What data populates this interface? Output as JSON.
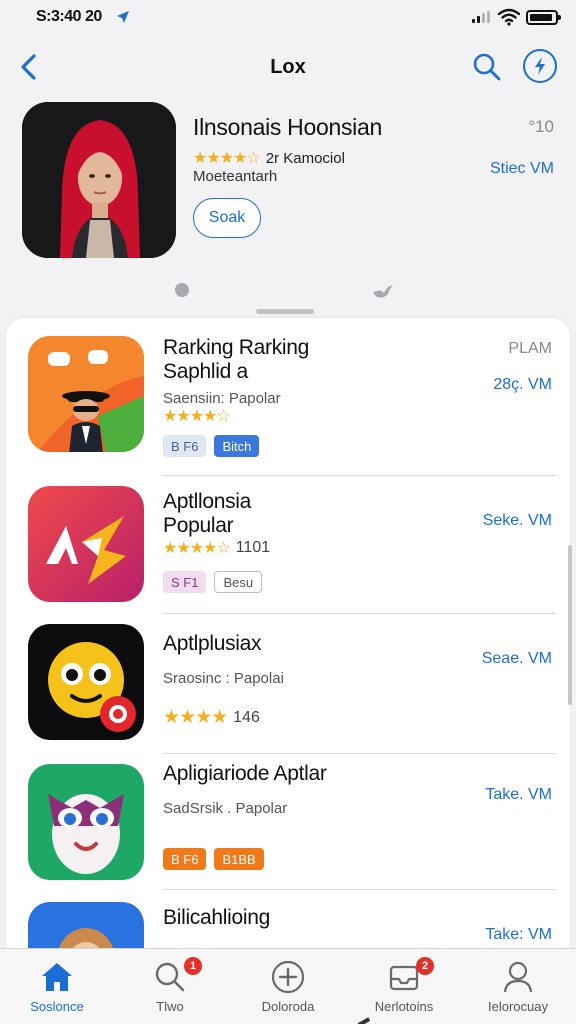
{
  "status_bar": {
    "time": "S:3:40 20"
  },
  "nav": {
    "title": "Lox"
  },
  "featured": {
    "title": "Ilnsonais Hoonsian",
    "age": "°10",
    "rating_stars": "★★★★☆",
    "rating_text": "2r Kamociol",
    "subtitle": "Moeteantarh",
    "price": "Stiec VM",
    "button_label": "Soak"
  },
  "apps": [
    {
      "name_line1": "Rarking Rarking",
      "name_line2": "Saphlid a",
      "subtitle": "Saensiin: Papolar",
      "stars": "★★★★☆",
      "rank": "PLAM",
      "price": "28ç. VM",
      "tags": [
        {
          "label": "B F6",
          "bg": "#dfe7f7",
          "fg": "#4a5f8c"
        },
        {
          "label": "Bitch",
          "bg": "#3a78e0",
          "fg": "#ffffff"
        }
      ]
    },
    {
      "name_line1": "Aptllonsia",
      "name_line2": "Popular",
      "stars": "★★★★☆",
      "rating_text": "1101",
      "price": "Seke. VM",
      "tags": [
        {
          "label": "S F1",
          "bg": "#f1dcf0",
          "fg": "#8a3a8a"
        },
        {
          "label": "Besu",
          "bg": "#ffffff",
          "fg": "#555555"
        }
      ]
    },
    {
      "name_line1": "Aptlplusiax",
      "subtitle": "Sraosinc : Papolai",
      "stars": "★★★★",
      "rating_text": "146",
      "price": "Seae. VM"
    },
    {
      "name_line1": "Apligiariode Aptlar",
      "subtitle": "SadSrsik . Papolar",
      "price": "Take. VM",
      "tags": [
        {
          "label": "B F6",
          "bg": "#f07a1a",
          "fg": "#ffffff"
        },
        {
          "label": "B1BB",
          "bg": "#f07a1a",
          "fg": "#ffffff"
        }
      ]
    },
    {
      "name_line1": "Bilicahlioing",
      "price": "Take: VM"
    }
  ],
  "tabs": [
    {
      "label": "Soslonce",
      "icon": "home-icon"
    },
    {
      "label": "Tlwo",
      "icon": "search-icon",
      "badge": "1"
    },
    {
      "label": "Doloroda",
      "icon": "add-circle-icon"
    },
    {
      "label": "Nerlotoins",
      "icon": "inbox-icon",
      "badge": "2"
    },
    {
      "label": "Ielorocuay",
      "icon": "profile-icon"
    }
  ],
  "colors": {
    "accent": "#1a6fd6",
    "star": "#f2b01e",
    "badge": "#e5302a"
  }
}
